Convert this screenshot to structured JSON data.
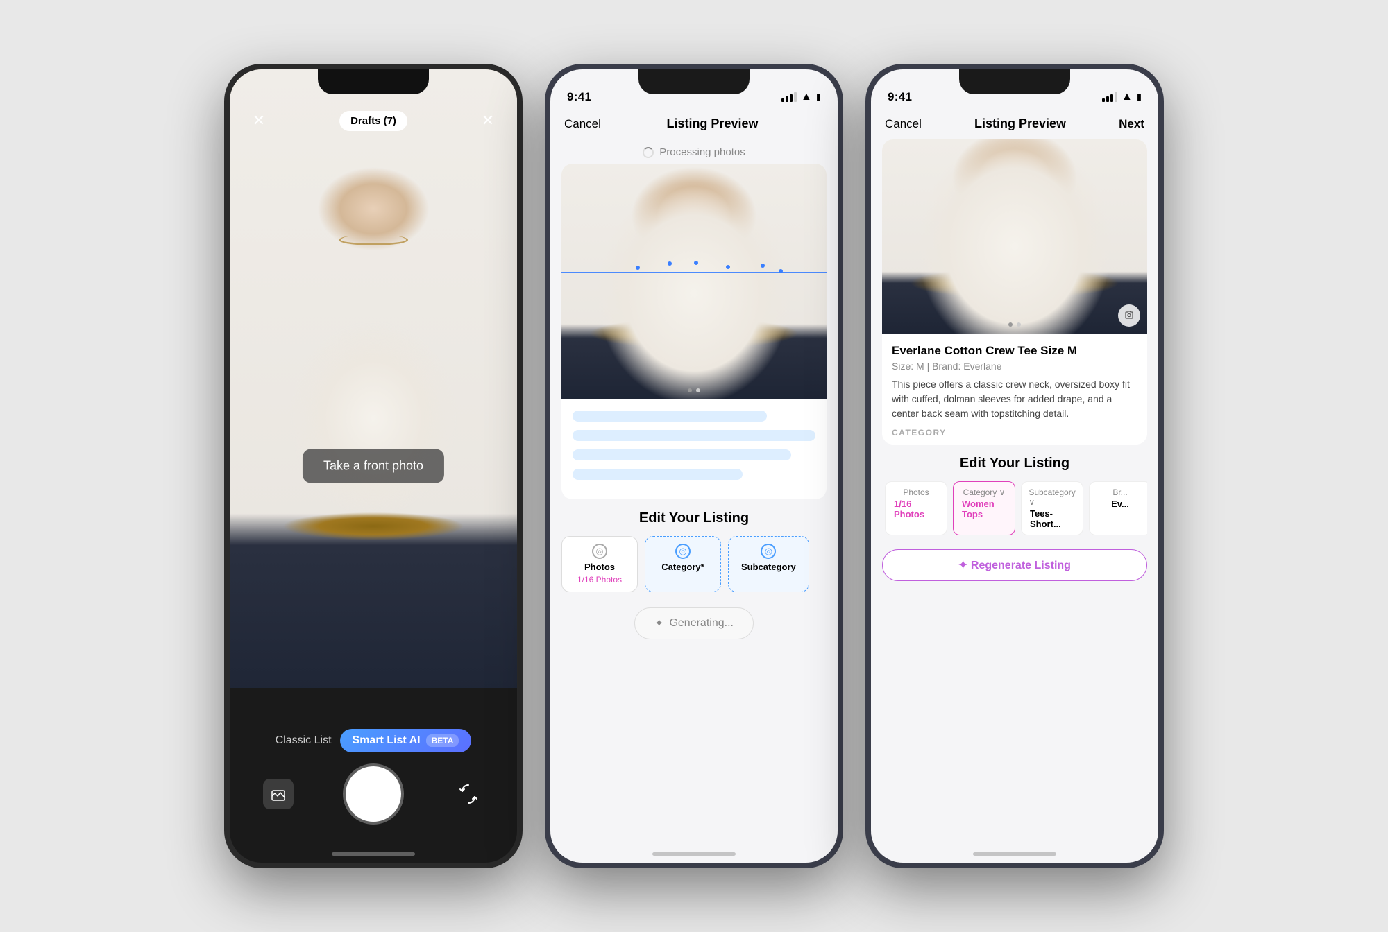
{
  "phone1": {
    "mode": "camera",
    "topBar": {
      "closeLabel": "✕",
      "draftsLabel": "Drafts (7)",
      "trashLabel": "✕"
    },
    "overlay": {
      "frontPhotoPrompt": "Take a front photo"
    },
    "bottomBar": {
      "classicLabel": "Classic List",
      "smartLabel": "Smart List AI",
      "betaLabel": "BETA"
    }
  },
  "phone2": {
    "statusTime": "9:41",
    "navBar": {
      "cancelLabel": "Cancel",
      "titleLabel": "Listing Preview",
      "nextLabel": ""
    },
    "processingText": "Processing photos",
    "editSection": {
      "titleLabel": "Edit Your Listing",
      "tabs": [
        {
          "icon": "◎",
          "label": "Photos",
          "sub": "1/16 Photos",
          "active": false
        },
        {
          "icon": "◎",
          "label": "Category*",
          "sub": "",
          "active": true
        },
        {
          "icon": "◎",
          "label": "Subcategory",
          "sub": "",
          "active": true
        }
      ]
    },
    "generatingLabel": "Generating..."
  },
  "phone3": {
    "statusTime": "9:41",
    "navBar": {
      "cancelLabel": "Cancel",
      "titleLabel": "Listing Preview",
      "nextLabel": "Next"
    },
    "product": {
      "title": "Everlane Cotton Crew Tee Size M",
      "meta": "Size: M | Brand: Everlane",
      "description": "This piece offers a classic crew neck, oversized boxy fit with cuffed, dolman sleeves for added drape, and a center back seam with topstitching detail.",
      "categoryLabel": "CATEGORY"
    },
    "editSection": {
      "titleLabel": "Edit Your Listing",
      "tabs": [
        {
          "label": "Photos",
          "sub": "1/16 Photos",
          "selected": false
        },
        {
          "label": "Category",
          "sub": "Women Tops",
          "selected": true
        },
        {
          "label": "Subcategory",
          "sub": "Tees- Short...",
          "selected": false
        },
        {
          "label": "Br...",
          "sub": "Ev...",
          "selected": false
        }
      ]
    },
    "regenerateLabel": "✦ Regenerate Listing"
  }
}
